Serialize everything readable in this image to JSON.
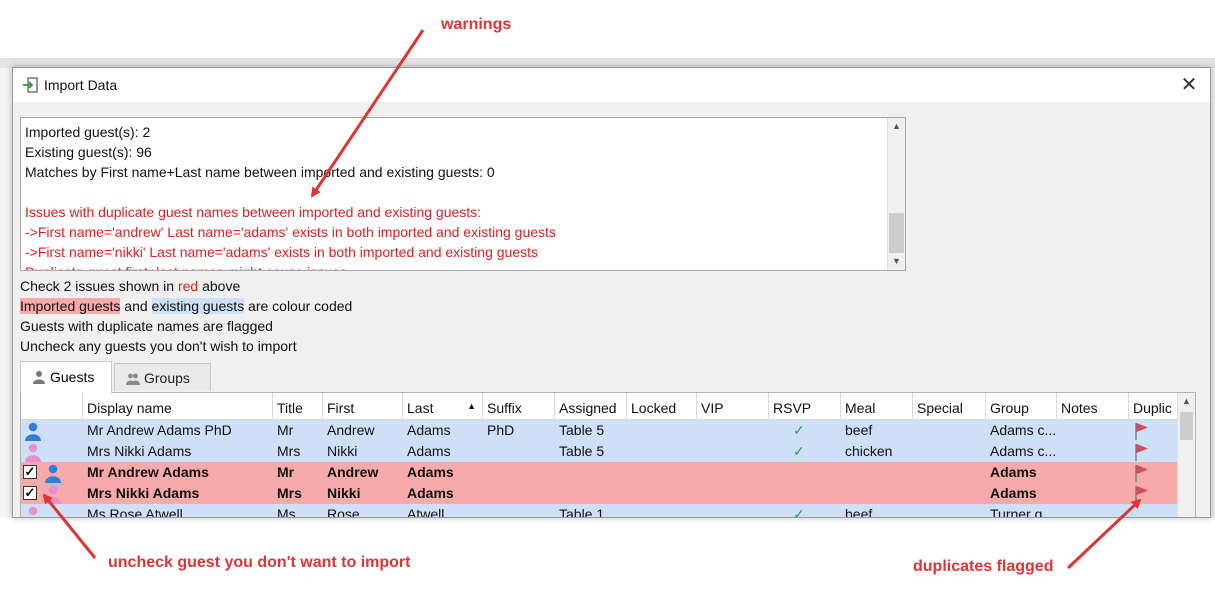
{
  "dialog": {
    "title": "Import Data",
    "close_label": "✕"
  },
  "log": {
    "lines": [
      {
        "text": "Imported guest(s): 2",
        "style": "normal"
      },
      {
        "text": "Existing guest(s): 96",
        "style": "normal"
      },
      {
        "text": "Matches by First name+Last name between imported and existing guests: 0",
        "style": "normal"
      },
      {
        "text": "",
        "style": "blank"
      },
      {
        "text": "Issues with duplicate guest names between imported and existing guests:",
        "style": "red"
      },
      {
        "text": "->First name='andrew' Last name='adams' exists in both imported and existing guests",
        "style": "red"
      },
      {
        "text": "->First name='nikki' Last name='adams' exists in both imported and existing guests",
        "style": "red"
      },
      {
        "text": "Duplicate guest first+last names might cause issues",
        "style": "red"
      }
    ]
  },
  "info": {
    "check_prefix": "Check 2 issues shown in ",
    "check_red": "red",
    "check_suffix": " above",
    "imported_label": "Imported guests",
    "and_text": " and ",
    "existing_label": "existing guests",
    "colour_suffix": " are colour coded",
    "flag_line": "Guests with duplicate names are flagged",
    "uncheck_line": "Uncheck any guests you don't wish to import"
  },
  "tabs": [
    {
      "label": "Guests",
      "active": true,
      "icon": "person-icon"
    },
    {
      "label": "Groups",
      "active": false,
      "icon": "group-icon"
    }
  ],
  "table": {
    "columns": [
      "Display name",
      "Title",
      "First",
      "Last",
      "Suffix",
      "Assigned",
      "Locked",
      "VIP",
      "RSVP",
      "Meal",
      "Special",
      "Group",
      "Notes",
      "Duplic"
    ],
    "sort_column": "Last",
    "sort_indicator": "▲",
    "rows": [
      {
        "type": "existing",
        "checked": null,
        "avatar": "male",
        "display": "Mr Andrew Adams PhD",
        "title": "Mr",
        "first": "Andrew",
        "last": "Adams",
        "suffix": "PhD",
        "assigned": "Table 5",
        "rsvp": "✓",
        "meal": "beef",
        "group": "Adams c...",
        "flag": true
      },
      {
        "type": "existing",
        "checked": null,
        "avatar": "female",
        "display": "Mrs Nikki Adams",
        "title": "Mrs",
        "first": "Nikki",
        "last": "Adams",
        "suffix": "",
        "assigned": "Table 5",
        "rsvp": "✓",
        "meal": "chicken",
        "group": "Adams c...",
        "flag": true
      },
      {
        "type": "imported",
        "checked": "✓",
        "avatar": "male",
        "display": "Mr Andrew Adams",
        "title": "Mr",
        "first": "Andrew",
        "last": "Adams",
        "suffix": "",
        "assigned": "",
        "rsvp": "",
        "meal": "",
        "group": "Adams",
        "flag": true
      },
      {
        "type": "imported",
        "checked": "✓",
        "avatar": "female",
        "display": "Mrs Nikki Adams",
        "title": "Mrs",
        "first": "Nikki",
        "last": "Adams",
        "suffix": "",
        "assigned": "",
        "rsvp": "",
        "meal": "",
        "group": "Adams",
        "flag": true
      },
      {
        "type": "existing",
        "checked": null,
        "avatar": "female",
        "display": "Ms Rose Atwell",
        "title": "Ms",
        "first": "Rose",
        "last": "Atwell",
        "suffix": "",
        "assigned": "Table 1",
        "rsvp": "✓",
        "meal": "beef",
        "group": "Turner g...",
        "flag": false
      }
    ]
  },
  "annotations": {
    "warnings": "warnings",
    "uncheck": "uncheck guest you don't want to import",
    "duplicates": "duplicates flagged"
  },
  "colors": {
    "imported_row": "#f6aaaa",
    "existing_row": "#cde0f7",
    "warning_text": "#e02020",
    "annotation": "#e03434",
    "male_avatar": "#2f7fd6",
    "female_avatar": "#e88fcf",
    "flag": "#d64a5a"
  }
}
